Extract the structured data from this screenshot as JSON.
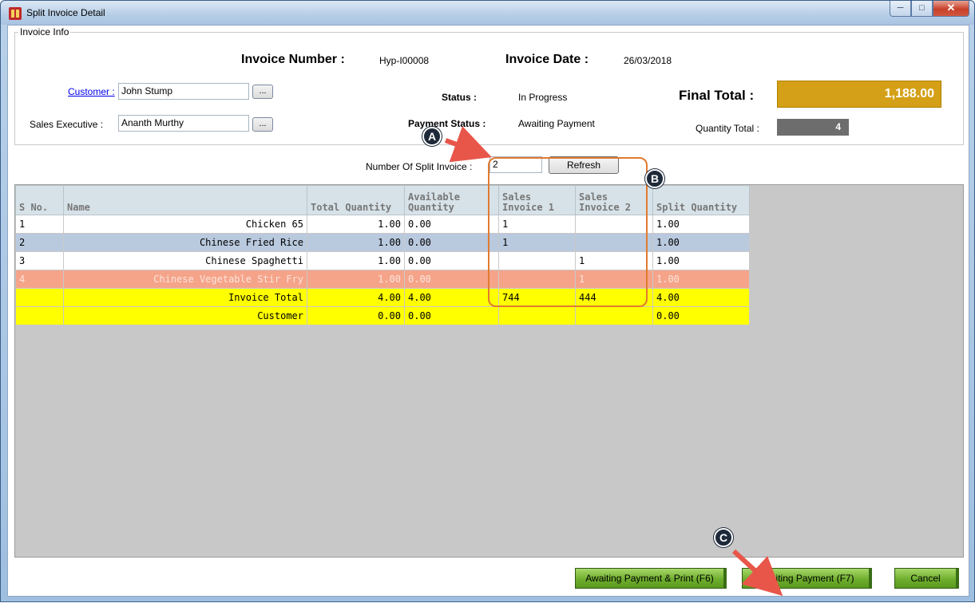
{
  "window": {
    "title": "Split Invoice Detail"
  },
  "invoice_info": {
    "caption": "Invoice Info",
    "invoice_number_label": "Invoice Number :",
    "invoice_number": "Hyp-I00008",
    "invoice_date_label": "Invoice Date :",
    "invoice_date": "26/03/2018",
    "customer_label": "Customer :",
    "customer": "John Stump",
    "sales_exec_label": "Sales Executive :",
    "sales_exec": "Ananth Murthy",
    "dots": "...",
    "status_label": "Status :",
    "status": "In Progress",
    "payment_status_label": "Payment Status :",
    "payment_status": "Awaiting Payment",
    "final_total_label": "Final Total :",
    "final_total": "1,188.00",
    "quantity_total_label": "Quantity Total :",
    "quantity_total": "4"
  },
  "split": {
    "label": "Number Of Split Invoice :",
    "value": "2",
    "refresh": "Refresh"
  },
  "grid": {
    "headers": [
      "S No.",
      "Name",
      "Total Quantity",
      "Available Quantity",
      "Sales Invoice 1",
      "Sales Invoice 2",
      "Split Quantity"
    ],
    "rows": [
      [
        "1",
        "Chicken 65",
        "1.00",
        "0.00",
        "1",
        "",
        "1.00"
      ],
      [
        "2",
        "Chinese Fried Rice",
        "1.00",
        "0.00",
        "1",
        "",
        "1.00"
      ],
      [
        "3",
        "Chinese Spaghetti",
        "1.00",
        "0.00",
        "",
        "1",
        "1.00"
      ],
      [
        "4",
        "Chinese Vegetable Stir Fry",
        "1.00",
        "0.00",
        "",
        "1",
        "1.00"
      ],
      [
        "",
        "Invoice Total",
        "4.00",
        "4.00",
        "744",
        "444",
        "4.00"
      ],
      [
        "",
        "Customer",
        "0.00",
        "0.00",
        "",
        "",
        "0.00"
      ]
    ]
  },
  "annotations": {
    "a": "A",
    "b": "B",
    "c": "C"
  },
  "footer": {
    "awaiting_print": "Awaiting Payment & Print (F6)",
    "awaiting": "Awaiting Payment (F7)",
    "cancel": "Cancel"
  },
  "colors": {
    "final_total_bg": "#d4a017",
    "qty_total_bg": "#6d6d6d",
    "salmon_row": "#f5a48a",
    "blue_row": "#b9c9de",
    "total_row": "#ffff00",
    "green_button": "#6fae2e",
    "annotation_arrow": "#e8564a"
  }
}
